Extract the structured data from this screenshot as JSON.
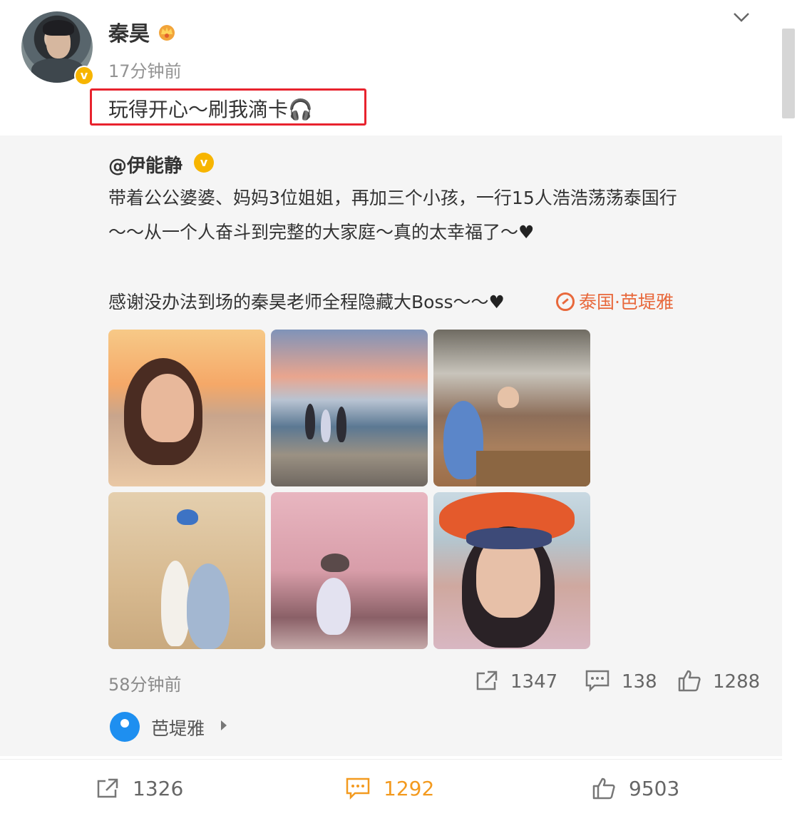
{
  "post": {
    "username": "秦昊",
    "time": "17分钟前",
    "text": "玩得开心～刷我滴卡🎧"
  },
  "repost": {
    "author": "@伊能静",
    "text_line1": "带着公公婆婆、妈妈3位姐姐，再加三个小孩，一行15人浩浩荡荡泰国行",
    "text_line2": "～～从一个人奋斗到完整的大家庭～真的太幸福了～",
    "text_line3": "感谢没办法到场的秦昊老师全程隐藏大Boss～～",
    "heart": "♥",
    "location_tag": "泰国·芭堤雅",
    "time": "58分钟前",
    "shares": "1347",
    "comments": "138",
    "likes": "1288",
    "place": "芭堤雅"
  },
  "footer": {
    "shares": "1326",
    "comments": "1292",
    "likes": "9503"
  },
  "colors": {
    "accent_orange": "#f39a1f",
    "highlight_red": "#e8232e",
    "verified_gold": "#f7b500",
    "location_orange": "#e8683b",
    "place_blue": "#1e8ff0"
  },
  "icons": [
    "chevron-down-icon",
    "crown-icon",
    "verified-icon",
    "share-icon",
    "comment-icon",
    "like-icon",
    "location-pin-icon"
  ]
}
